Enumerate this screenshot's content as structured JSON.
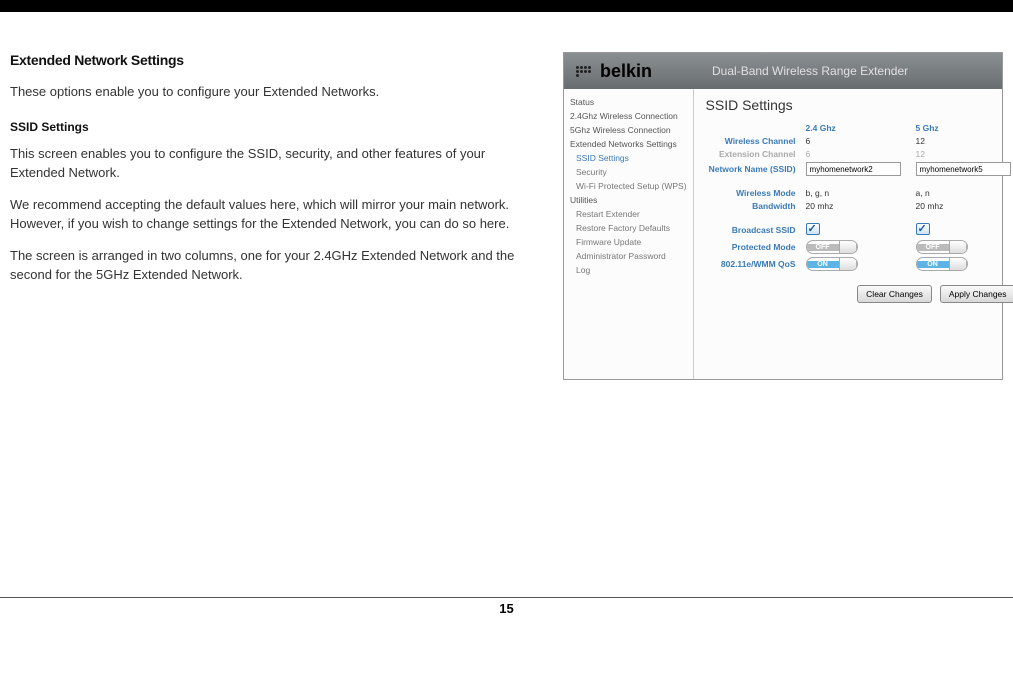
{
  "doc": {
    "title": "Extended Network Settings",
    "intro": "These options enable you to configure your Extended Networks.",
    "subheading": "SSID Settings",
    "p1": "This screen enables you to configure the SSID, security, and other features of your Extended Network.",
    "p2": "We recommend accepting the default values here, which will mirror your main network. However, if you wish to change settings for the Extended Network, you can do so here.",
    "p3": "The screen is arranged in two columns, one for your 2.4GHz Extended Network and the second for the 5GHz Extended Network."
  },
  "router": {
    "brand": "belkin",
    "header_title": "Dual-Band Wireless Range Extender",
    "sidebar": {
      "items": [
        {
          "label": "Status",
          "sub": false
        },
        {
          "label": "2.4Ghz Wireless Connection",
          "sub": false
        },
        {
          "label": "5Ghz Wireless Connection",
          "sub": false
        },
        {
          "label": "Extended Networks Settings",
          "sub": false
        },
        {
          "label": "SSID Settings",
          "sub": true,
          "active": true
        },
        {
          "label": "Security",
          "sub": true
        },
        {
          "label": "Wi-Fi Protected Setup (WPS)",
          "sub": true
        },
        {
          "label": "Utilities",
          "sub": false
        },
        {
          "label": "Restart Extender",
          "sub": true
        },
        {
          "label": "Restore Factory Defaults",
          "sub": true
        },
        {
          "label": "Firmware Update",
          "sub": true
        },
        {
          "label": "Administrator Password",
          "sub": true
        },
        {
          "label": "Log",
          "sub": true
        }
      ]
    },
    "main": {
      "title": "SSID Settings",
      "col24": "2.4 Ghz",
      "col5": "5 Ghz",
      "labels": {
        "wireless_channel": "Wireless Channel",
        "extension_channel": "Extension Channel",
        "network_name": "Network Name (SSID)",
        "wireless_mode": "Wireless Mode",
        "bandwidth": "Bandwidth",
        "broadcast_ssid": "Broadcast SSID",
        "protected_mode": "Protected Mode",
        "wmm_qos": "802.11e/WMM QoS"
      },
      "values24": {
        "wireless_channel": "6",
        "extension_channel": "6",
        "ssid": "myhomenetwork2",
        "wireless_mode": "b, g, n",
        "bandwidth": "20 mhz",
        "broadcast_ssid": true,
        "protected_mode": "OFF",
        "wmm_qos": "ON"
      },
      "values5": {
        "wireless_channel": "12",
        "extension_channel": "12",
        "ssid": "myhomenetwork5",
        "wireless_mode": "a, n",
        "bandwidth": "20 mhz",
        "broadcast_ssid": true,
        "protected_mode": "OFF",
        "wmm_qos": "ON"
      },
      "buttons": {
        "clear": "Clear Changes",
        "apply": "Apply Changes"
      }
    }
  },
  "page_number": "15"
}
